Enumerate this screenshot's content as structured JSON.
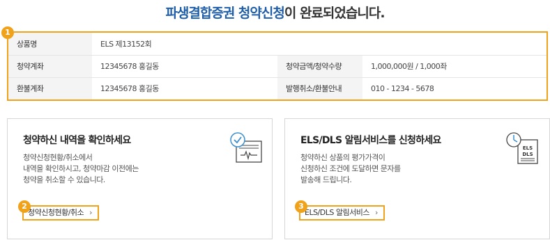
{
  "title": {
    "highlight": "파생결합증권 청약신청",
    "rest": "이 완료되었습니다."
  },
  "badges": [
    "1",
    "2",
    "3"
  ],
  "info": {
    "rows": [
      [
        {
          "label": "상품명",
          "value": "ELS 제13152회"
        }
      ],
      [
        {
          "label": "청약계좌",
          "value": "12345678 홍길동"
        },
        {
          "label": "청약금액/청약수량",
          "value": "1,000,000원 / 1,000좌"
        }
      ],
      [
        {
          "label": "환불계좌",
          "value": "12345678 홍길동"
        },
        {
          "label": "발행취소/환불안내",
          "value": "010 - 1234 - 5678"
        }
      ]
    ]
  },
  "left_box": {
    "heading": "청약하신 내역을 확인하세요",
    "desc": [
      "청약신청현황/취소에서",
      "내역을 확인하시고, 청약마감 이전에는",
      "청약을 취소할 수 있습니다."
    ],
    "button_label": "청약신청현황/취소",
    "icon": "check-document-icon"
  },
  "right_box": {
    "heading": "ELS/DLS 알림서비스를 신청하세요",
    "desc": [
      "청약하신 상품의 평가가격이",
      "신청하신 조건에 도달하면 문자를",
      "발송해 드립니다."
    ],
    "button_label": "ELS/DLS 알림서비스",
    "icon": "clock-document-icon",
    "icon_text": [
      "ELS",
      "DLS"
    ]
  },
  "colors": {
    "accent": "#f0a21b",
    "title_highlight": "#1f5ea8",
    "icon_blue": "#3a8fd0"
  },
  "arrow_glyph": "›"
}
